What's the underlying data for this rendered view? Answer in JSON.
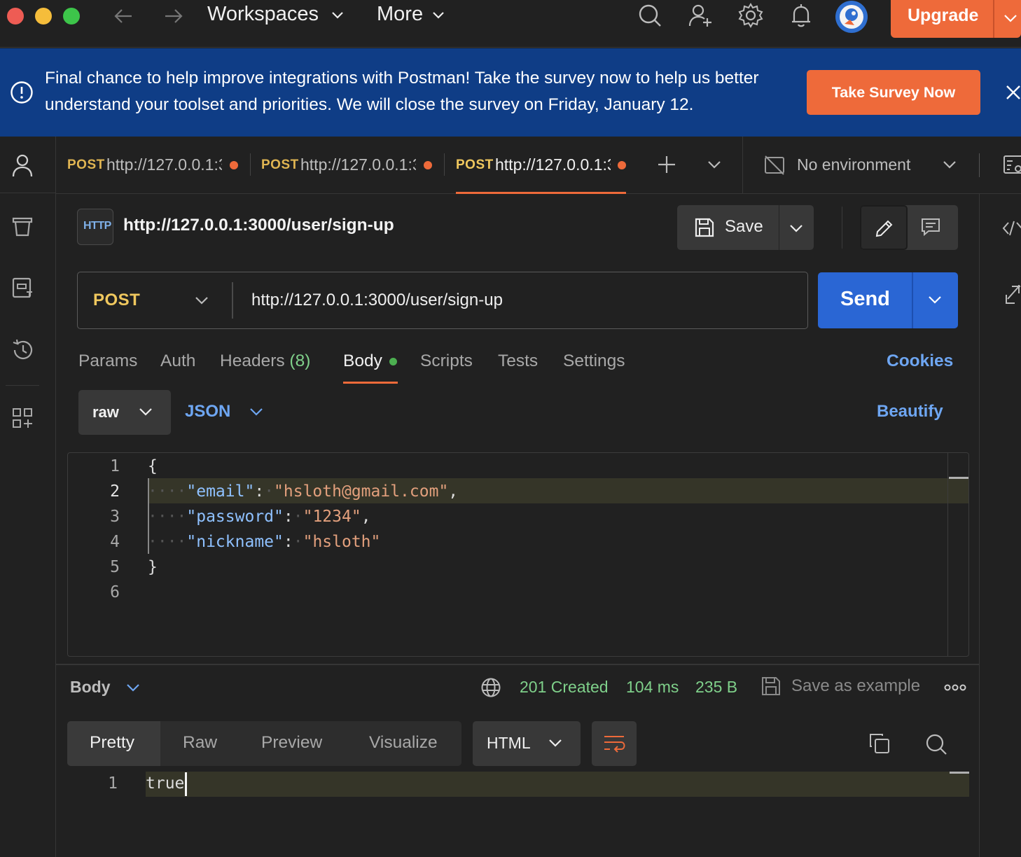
{
  "titlebar": {
    "workspaces_label": "Workspaces",
    "more_label": "More",
    "upgrade_label": "Upgrade"
  },
  "banner": {
    "message": "Final chance to help improve integrations with Postman! Take the survey now to help us better understand your toolset and priorities. We will close the survey on Friday, January 12.",
    "button_label": "Take Survey Now"
  },
  "tabs": [
    {
      "method": "POST",
      "url": "http://127.0.0.1:3"
    },
    {
      "method": "POST",
      "url": "http://127.0.0.1:3"
    },
    {
      "method": "POST",
      "url": "http://127.0.0.1:3"
    }
  ],
  "environment": {
    "label": "No environment"
  },
  "request": {
    "title": "http://127.0.0.1:3000/user/sign-up",
    "badge": "HTTP",
    "save_label": "Save",
    "method": "POST",
    "url": "http://127.0.0.1:3000/user/sign-up",
    "send_label": "Send"
  },
  "request_tabs": {
    "params": "Params",
    "auth": "Auth",
    "headers": "Headers",
    "headers_count": "(8)",
    "body": "Body",
    "scripts": "Scripts",
    "tests": "Tests",
    "settings": "Settings",
    "cookies": "Cookies"
  },
  "body_options": {
    "mode": "raw",
    "language": "JSON",
    "beautify": "Beautify"
  },
  "editor": {
    "line_numbers": [
      "1",
      "2",
      "3",
      "4",
      "5",
      "6"
    ],
    "open_brace": "{",
    "close_brace": "}",
    "fields": [
      {
        "key": "\"email\"",
        "value": "\"hsloth@gmail.com\"",
        "trail": ","
      },
      {
        "key": "\"password\"",
        "value": "\"1234\"",
        "trail": ","
      },
      {
        "key": "\"nickname\"",
        "value": "\"hsloth\"",
        "trail": ""
      }
    ]
  },
  "response": {
    "section_label": "Body",
    "status": "201 Created",
    "time": "104 ms",
    "size": "235 B",
    "save_example": "Save as example",
    "views": [
      "Pretty",
      "Raw",
      "Preview",
      "Visualize"
    ],
    "format": "HTML",
    "line_number": "1",
    "content": "true"
  },
  "colors": {
    "accent": "#ee6a3a",
    "banner_bg": "#0f3d86",
    "send_blue": "#2a66d4",
    "status_green": "#7fd08a",
    "link_blue": "#6ea6f2",
    "method_yellow": "#f0c85e"
  }
}
